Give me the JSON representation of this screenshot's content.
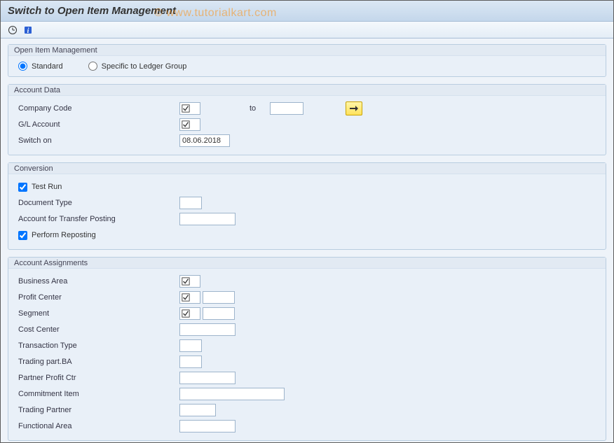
{
  "header": {
    "title": "Switch to Open Item Management"
  },
  "watermark": "© www.tutorialkart.com",
  "groups": {
    "oim": {
      "title": "Open Item Management",
      "standard_label": "Standard",
      "specific_label": "Specific to Ledger Group",
      "selected": "standard"
    },
    "account_data": {
      "title": "Account Data",
      "company_code_label": "Company Code",
      "company_code_value": "",
      "to_label": "to",
      "company_code_to_value": "",
      "gl_account_label": "G/L Account",
      "gl_account_value": "",
      "switch_on_label": "Switch on",
      "switch_on_value": "08.06.2018"
    },
    "conversion": {
      "title": "Conversion",
      "test_run_label": "Test Run",
      "test_run_checked": true,
      "document_type_label": "Document Type",
      "document_type_value": "",
      "transfer_account_label": "Account for Transfer Posting",
      "transfer_account_value": "",
      "perform_reposting_label": "Perform Reposting",
      "perform_reposting_checked": true
    },
    "assignments": {
      "title": "Account Assignments",
      "business_area_label": "Business Area",
      "business_area_value": "",
      "profit_center_label": "Profit Center",
      "profit_center_value": "",
      "segment_label": "Segment",
      "segment_value": "",
      "cost_center_label": "Cost Center",
      "cost_center_value": "",
      "transaction_type_label": "Transaction Type",
      "transaction_type_value": "",
      "trading_part_ba_label": "Trading part.BA",
      "trading_part_ba_value": "",
      "partner_profit_ctr_label": "Partner Profit Ctr",
      "partner_profit_ctr_value": "",
      "commitment_item_label": "Commitment Item",
      "commitment_item_value": "",
      "trading_partner_label": "Trading Partner",
      "trading_partner_value": "",
      "functional_area_label": "Functional Area",
      "functional_area_value": ""
    }
  }
}
